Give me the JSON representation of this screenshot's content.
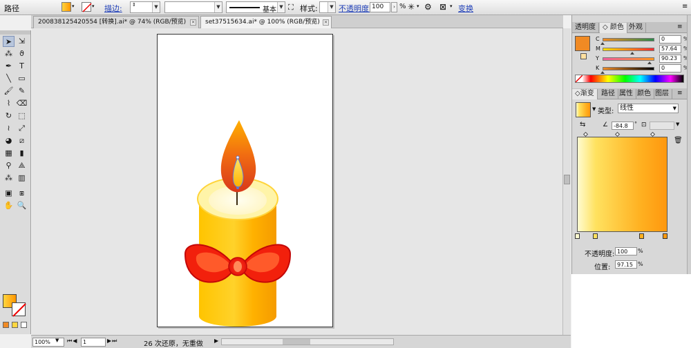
{
  "control_bar": {
    "object_label": "路径",
    "stroke_label": "描边:",
    "stroke_profile": "基本",
    "style_label": "样式:",
    "opacity_label": "不透明度:",
    "opacity_value": "100",
    "opacity_unit": "%",
    "transform_label": "变换"
  },
  "tabs": [
    {
      "title": "200838125420554 [转换].ai* @ 74% (RGB/预览)",
      "close": "×"
    },
    {
      "title": "set37515634.ai* @ 100% (RGB/预览)",
      "close": "×"
    }
  ],
  "tools": {
    "icons": [
      "selection-icon",
      "direct-selection-icon",
      "magic-wand-icon",
      "lasso-icon",
      "pen-icon",
      "type-icon",
      "line-icon",
      "rectangle-icon",
      "paintbrush-icon",
      "pencil-icon",
      "blob-brush-icon",
      "eraser-icon",
      "rotate-icon",
      "scale-icon",
      "warp-icon",
      "free-transform-icon",
      "shape-builder-icon",
      "perspective-icon",
      "mesh-icon",
      "gradient-icon",
      "eyedropper-icon",
      "blend-icon",
      "symbol-sprayer-icon",
      "graph-icon",
      "artboard-icon",
      "slice-icon",
      "hand-icon",
      "zoom-icon"
    ]
  },
  "color_panel": {
    "tabs": [
      "透明度",
      "颜色",
      "外观",
      ""
    ],
    "active_tab": 1,
    "swatch_color": "#f08a24",
    "channels": [
      {
        "name": "C",
        "value": "0",
        "unit": "%",
        "pos": 0.0
      },
      {
        "name": "M",
        "value": "57.64",
        "unit": "%",
        "pos": 0.5764
      },
      {
        "name": "Y",
        "value": "90.23",
        "unit": "%",
        "pos": 0.9023
      },
      {
        "name": "K",
        "value": "0",
        "unit": "%",
        "pos": 0.0
      }
    ]
  },
  "gradient_panel": {
    "tabs": [
      "渐变",
      "路径",
      "属性",
      "颜色",
      "图层"
    ],
    "active_tab": 0,
    "type_label": "类型:",
    "type_value": "线性",
    "angle_value": "-84.8",
    "angle_unit": "°",
    "opacity_label": "不透明度:",
    "opacity_value": "100",
    "opacity_unit": "%",
    "location_label": "位置:",
    "location_value": "97.15",
    "location_unit": "%",
    "stops": [
      {
        "color": "#fffbd0",
        "location": 0.0
      },
      {
        "color": "#ffe260",
        "location": 0.2
      },
      {
        "color": "#ffb020",
        "location": 0.71
      },
      {
        "color": "#ff9a10",
        "location": 0.9715
      }
    ]
  },
  "status_bar": {
    "zoom": "100%",
    "page": "1",
    "undo_text": "26 次还原，无重做"
  },
  "colors": {
    "selection_blue": "#5b7ad8",
    "candle_orange": "#ffa800",
    "bow_red": "#e8140a"
  }
}
